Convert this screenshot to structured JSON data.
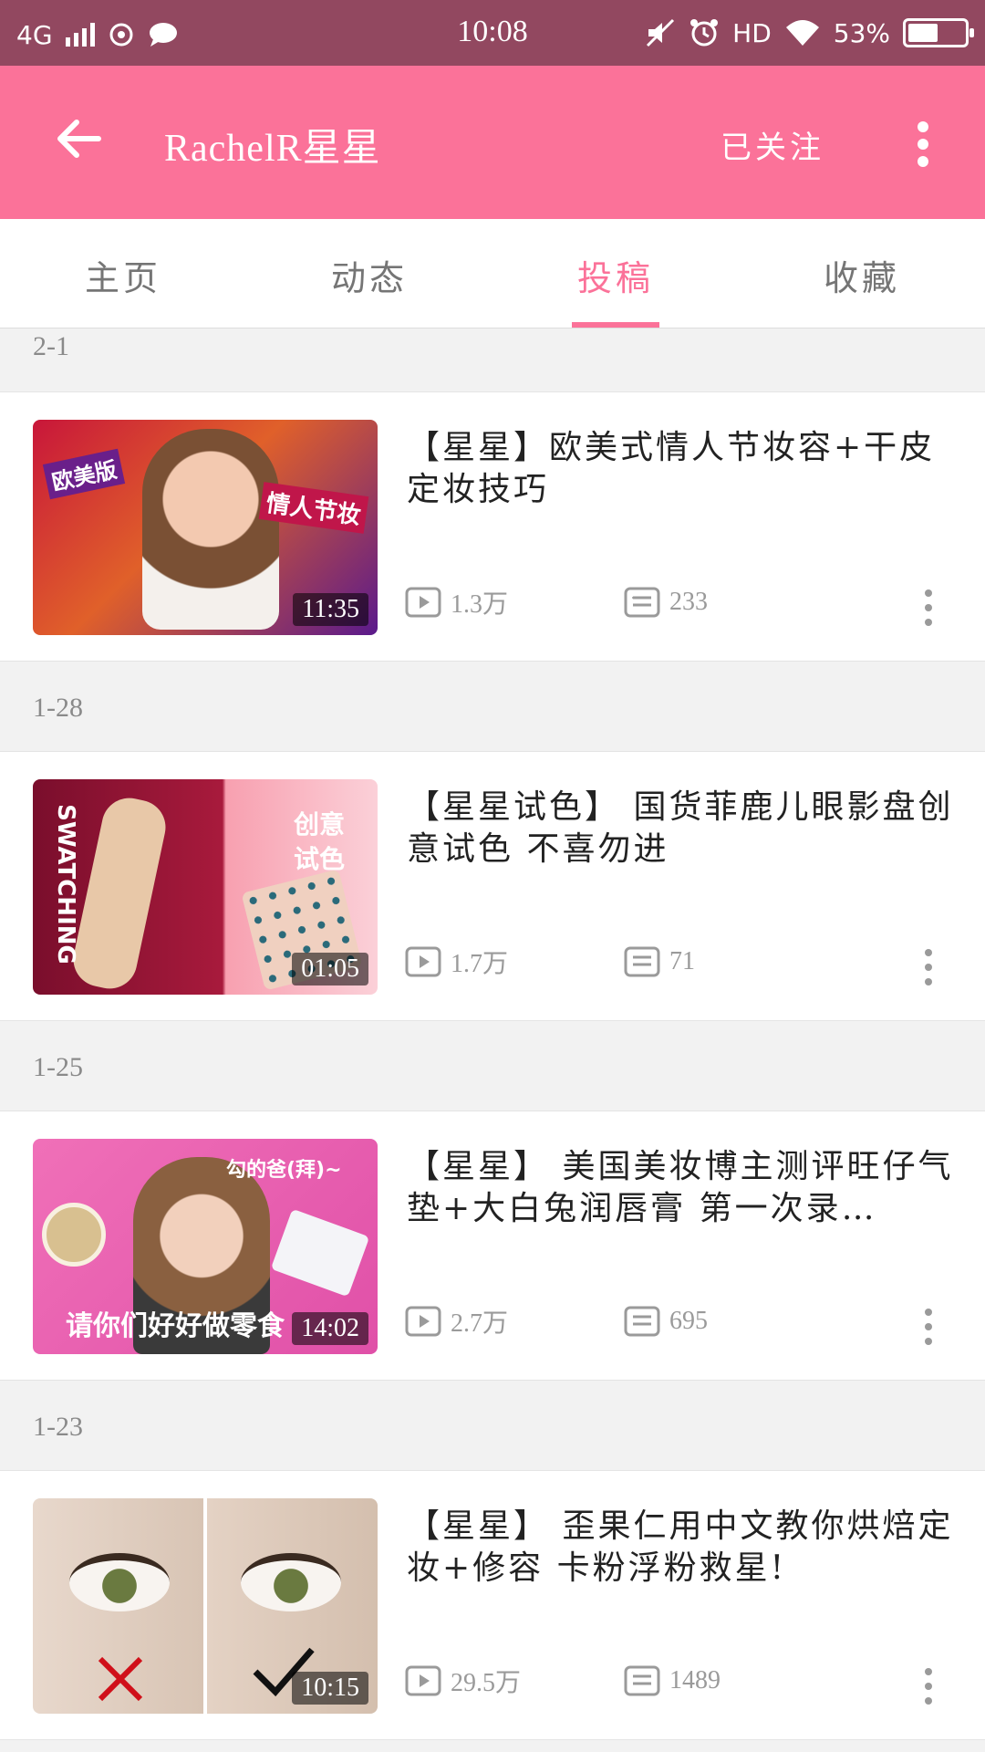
{
  "status_bar": {
    "network": "4G",
    "time": "10:08",
    "hd": "HD",
    "battery": "53%",
    "battery_level": 0.53
  },
  "app_bar": {
    "title": "RachelR星星",
    "follow_label": "已关注"
  },
  "tabs": [
    {
      "label": "主页",
      "active": false
    },
    {
      "label": "动态",
      "active": false
    },
    {
      "label": "投稿",
      "active": true
    },
    {
      "label": "收藏",
      "active": false
    }
  ],
  "videos": [
    {
      "date": "2-1",
      "title": "【星星】欧美式情人节妆容+干皮定妆技巧",
      "duration": "11:35",
      "views": "1.3万",
      "comments": "233",
      "thumb_texts": [
        "欧美版",
        "情人节妆"
      ]
    },
    {
      "date": "1-28",
      "title": "【星星试色】 国货菲鹿儿眼影盘创意试色 不喜勿进",
      "duration": "01:05",
      "views": "1.7万",
      "comments": "71",
      "thumb_texts": [
        "SWATCHING",
        "创意",
        "试色"
      ]
    },
    {
      "date": "1-25",
      "title": "【星星】 美国美妆博主测评旺仔气垫+大白兔润唇膏 第一次录…",
      "duration": "14:02",
      "views": "2.7万",
      "comments": "695",
      "thumb_texts": [
        "勾的爸(拜)~",
        "请你们好好做零食"
      ]
    },
    {
      "date": "1-23",
      "title": "【星星】 歪果仁用中文教你烘焙定妆+修容 卡粉浮粉救星!",
      "duration": "10:15",
      "views": "29.5万",
      "comments": "1489",
      "thumb_texts": []
    }
  ],
  "colors": {
    "status_bar": "#924860",
    "accent": "#fb7299",
    "text_muted": "#9a9a9a"
  },
  "icons": {
    "back": "arrow-left",
    "more": "vertical-dots",
    "play": "play-box",
    "comment": "comment-list"
  }
}
